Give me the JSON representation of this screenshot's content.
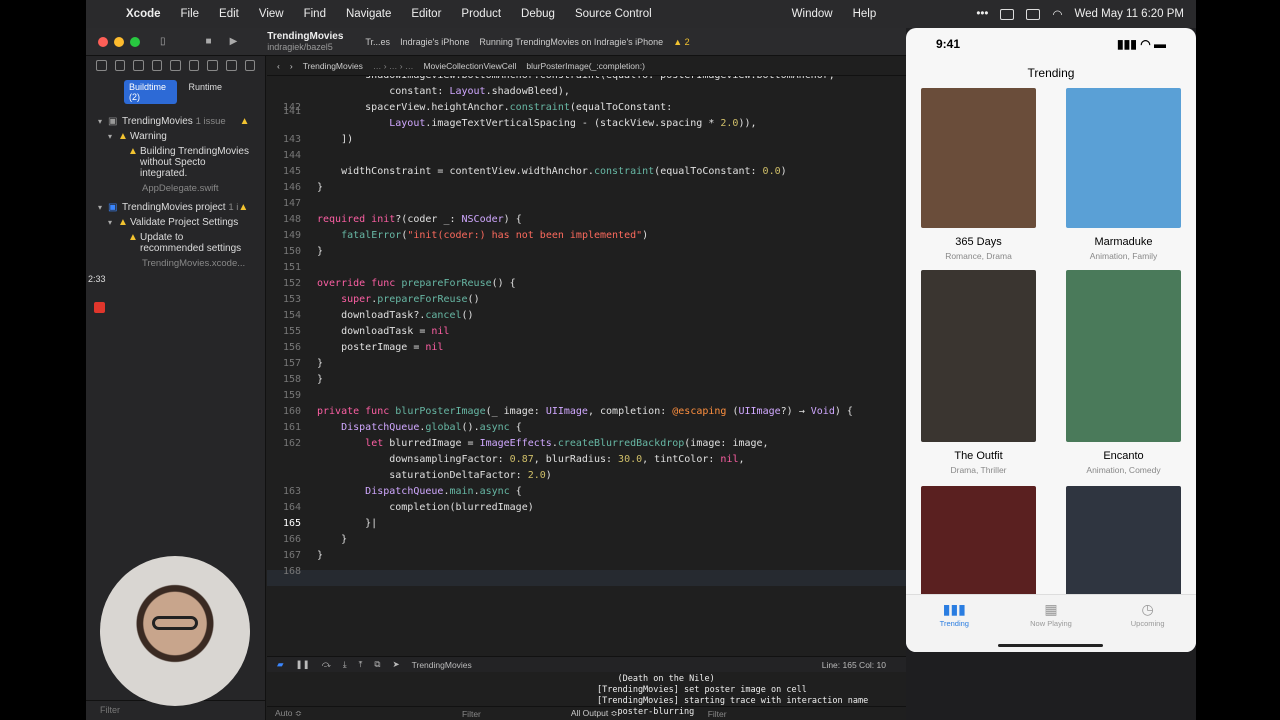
{
  "menubar": {
    "app": "Xcode",
    "items": [
      "File",
      "Edit",
      "View",
      "Find",
      "Navigate",
      "Editor",
      "Product",
      "Debug",
      "Source Control",
      "Window",
      "Help"
    ],
    "datetime": "Wed May 11  6:20 PM"
  },
  "titlebar": {
    "project": "TrendingMovies",
    "branch": "indragiek/bazel5",
    "scheme": "Tr...es",
    "device": "Indragie's iPhone",
    "status": "Running TrendingMovies on Indragie's iPhone",
    "warnings": "2"
  },
  "navigator": {
    "seg_buildtime": "Buildtime (2)",
    "seg_runtime": "Runtime",
    "items": [
      {
        "label": "TrendingMovies",
        "note": "1 issue"
      },
      {
        "label": "Warning"
      },
      {
        "label": "Building TrendingMovies without Specto integrated."
      },
      {
        "label": "AppDelegate.swift"
      },
      {
        "label": "TrendingMovies project",
        "note": "1 i"
      },
      {
        "label": "Validate Project Settings"
      },
      {
        "label": "Update to recommended settings"
      },
      {
        "label": "TrendingMovies.xcode..."
      }
    ],
    "filter": "Filter",
    "timer": "2:33"
  },
  "jumpbar": {
    "file": "TrendingMovies",
    "cell": "MovieCollectionViewCell",
    "func": "blurPosterImage(_:completion:)"
  },
  "editor": {
    "cursor": "Line: 165  Col: 10"
  },
  "debug": {
    "target": "TrendingMovies"
  },
  "console": {
    "output": "    (Death on the Nile)\n[TrendingMovies] set poster image on cell\n[TrendingMovies] starting trace with interaction name\n    poster-blurring",
    "auto": "Auto ≎",
    "filter": "Filter",
    "all_output": "All Output ≎"
  },
  "phone": {
    "time": "9:41",
    "title": "Trending",
    "movies": [
      {
        "title": "365 Days",
        "genre": "Romance, Drama",
        "color": "#6a4d3a"
      },
      {
        "title": "Marmaduke",
        "genre": "Animation, Family",
        "color": "#5aa0d6"
      },
      {
        "title": "The Outfit",
        "genre": "Drama, Thriller",
        "color": "#3a3530"
      },
      {
        "title": "Encanto",
        "genre": "Animation, Comedy",
        "color": "#4a7a5a"
      },
      {
        "title": "",
        "genre": "",
        "color": "#5a2020"
      },
      {
        "title": "",
        "genre": "",
        "color": "#2f3540"
      }
    ],
    "tabs": [
      "Trending",
      "Now Playing",
      "Upcoming"
    ]
  }
}
